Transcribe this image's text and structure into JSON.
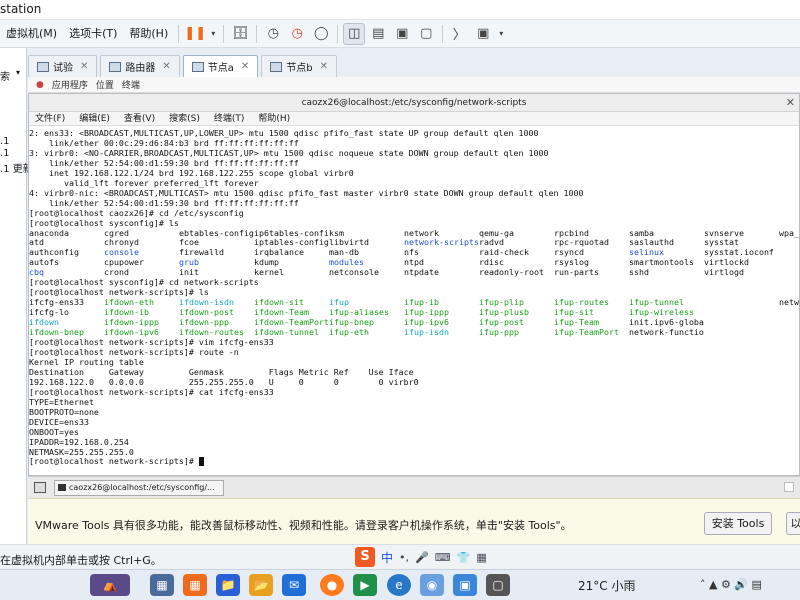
{
  "window": {
    "title": "station"
  },
  "menubar": {
    "items": [
      "虚拟机(M)",
      "选项卡(T)",
      "帮助(H)"
    ]
  },
  "sidebar": {
    "search_label": "索",
    "lines": [
      ".1",
      ".1",
      ".1 更新"
    ]
  },
  "tabs": [
    {
      "label": "试验",
      "active": false
    },
    {
      "label": "路由器",
      "active": false
    },
    {
      "label": "节点a",
      "active": true
    },
    {
      "label": "节点b",
      "active": false
    }
  ],
  "guestbar": {
    "items": [
      "应用程序",
      "位置",
      "终端"
    ]
  },
  "terminal": {
    "title": "caozx26@localhost:/etc/sysconfig/network-scripts",
    "menu": [
      "文件(F)",
      "编辑(E)",
      "查看(V)",
      "搜索(S)",
      "终端(T)",
      "帮助(H)"
    ],
    "lines": [
      "2: ens33: <BROADCAST,MULTICAST,UP,LOWER_UP> mtu 1500 qdisc pfifo_fast state UP group default qlen 1000",
      "    link/ether 00:0c:29:d6:84:b3 brd ff:ff:ff:ff:ff:ff",
      "3: virbr0: <NO-CARRIER,BROADCAST,MULTICAST,UP> mtu 1500 qdisc noqueue state DOWN group default qlen 1000",
      "    link/ether 52:54:00:d1:59:30 brd ff:ff:ff:ff:ff:ff",
      "    inet 192.168.122.1/24 brd 192.168.122.255 scope global virbr0",
      "       valid_lft forever preferred_lft forever",
      "4: virbr0-nic: <BROADCAST,MULTICAST> mtu 1500 qdisc pfifo_fast master virbr0 state DOWN group default qlen 1000",
      "    link/ether 52:54:00:d1:59:30 brd ff:ff:ff:ff:ff:ff",
      "[root@localhost caozx26]# cd /etc/sysconfig",
      "[root@localhost sysconfig]# ls"
    ],
    "ls_sysconfig": [
      [
        "anaconda",
        "cgred",
        "ebtables-config",
        "ip6tables-config",
        "ksm",
        "network",
        "qemu-ga",
        "rpcbind",
        "samba",
        "svnserve",
        "wpa_supplicant"
      ],
      [
        "atd",
        "chronyd",
        "fcoe",
        "iptables-config",
        "libvirtd",
        "network-scripts",
        "radvd",
        "rpc-rquotad",
        "saslauthd",
        "sysstat",
        ""
      ],
      [
        "authconfig",
        "console",
        "firewalld",
        "irqbalance",
        "man-db",
        "nfs",
        "raid-check",
        "rsyncd",
        "selinux",
        "sysstat.ioconf",
        ""
      ],
      [
        "autofs",
        "cpupower",
        "grub",
        "kdump",
        "modules",
        "ntpd",
        "rdisc",
        "rsyslog",
        "smartmontools",
        "virtlockd",
        ""
      ],
      [
        "cbq",
        "crond",
        "init",
        "kernel",
        "netconsole",
        "ntpdate",
        "readonly-root",
        "run-parts",
        "sshd",
        "virtlogd",
        ""
      ]
    ],
    "ls_colored": [
      "network-scripts",
      "console",
      "selinux",
      "grub",
      "modules",
      "cbq"
    ],
    "cd_line": "[root@localhost sysconfig]# cd network-scripts",
    "ls_line": "[root@localhost network-scripts]# ls",
    "ls_netscripts": [
      [
        "ifcfg-ens33",
        "ifdown-eth",
        "ifdown-isdn",
        "ifdown-sit",
        "ifup",
        "ifup-ib",
        "ifup-plip",
        "ifup-routes",
        "ifup-tunnel",
        "",
        "network-functions-ipv6"
      ],
      [
        "ifcfg-lo",
        "ifdown-ib",
        "ifdown-post",
        "ifdown-Team",
        "ifup-aliases",
        "ifup-ippp",
        "ifup-plusb",
        "ifup-sit",
        "ifup-wireless",
        "",
        ""
      ],
      [
        "ifdown",
        "ifdown-ippp",
        "ifdown-ppp",
        "ifdown-TeamPort",
        "ifup-bnep",
        "ifup-ipv6",
        "ifup-post",
        "ifup-Team",
        "init.ipv6-global",
        "",
        ""
      ],
      [
        "ifdown-bnep",
        "ifdown-ipv6",
        "ifdown-routes",
        "ifdown-tunnel",
        "ifup-eth",
        "ifup-isdn",
        "ifup-ppp",
        "ifup-TeamPort",
        "network-functions",
        "",
        ""
      ]
    ],
    "ls_netscripts_plain": [
      "ifcfg-ens33",
      "ifcfg-lo",
      "init.ipv6-global",
      "network-functions",
      "network-functions-ipv6"
    ],
    "ls_netscripts_cyan": [
      "ifdown",
      "ifup",
      "ifdown-isdn",
      "ifup-isdn"
    ],
    "after_lines": [
      "[root@localhost network-scripts]# vim ifcfg-ens33",
      "[root@localhost network-scripts]# route -n",
      "Kernel IP routing table",
      "Destination     Gateway         Genmask         Flags Metric Ref    Use Iface",
      "192.168.122.0   0.0.0.0         255.255.255.0   U     0      0        0 virbr0",
      "[root@localhost network-scripts]# cat ifcfg-ens33",
      "TYPE=Ethernet",
      "BOOTPROTO=none",
      "DEVICE=ens33",
      "ONBOOT=yes",
      "IPADDR=192.168.0.254",
      "NETMASK=255.255.255.0"
    ],
    "prompt": "[root@localhost network-scripts]# "
  },
  "guest_taskbar": {
    "item": "caozx26@localhost:/etc/sysconfig/..."
  },
  "tools_bar": {
    "message": "VMware Tools 具有很多功能，能改善鼠标移动性、视频和性能。请登录客户机操作系统，单击\"安装 Tools\"。",
    "install_button": "安装 Tools",
    "second_button": "以"
  },
  "status": {
    "text": "在虚拟机内部单击或按 Ctrl+G。"
  },
  "ime": {
    "logo": "S",
    "lang": "中"
  },
  "taskbar": {
    "weather": "21°C 小雨",
    "colors": {
      "orange": "#f06a1d",
      "blue": "#1f6fd6",
      "green": "#1f8f4a",
      "firefox": "#ff7b1c",
      "edge": "#2877c8"
    }
  }
}
